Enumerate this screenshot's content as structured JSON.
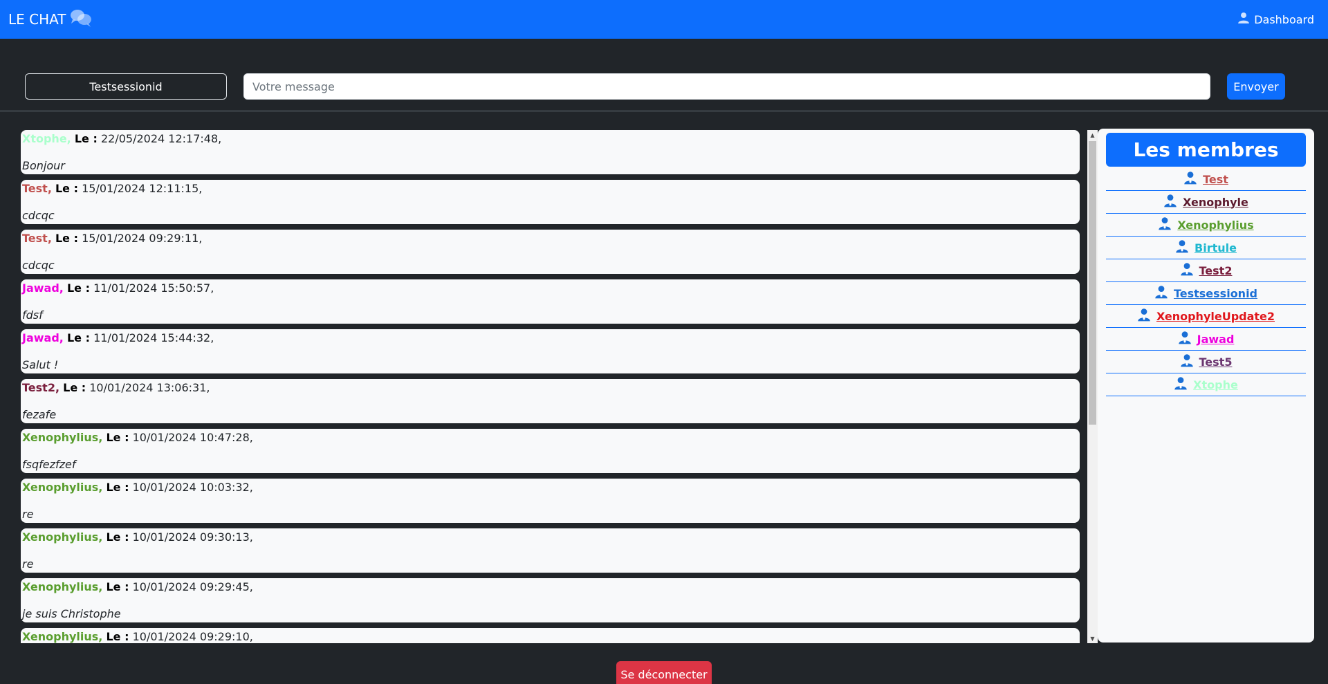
{
  "navbar": {
    "brand": "LE CHAT",
    "dashboard_label": "Dashboard",
    "brand_color": "#0d6efd"
  },
  "compose": {
    "session_name": "Testsessionid",
    "message_placeholder": "Votre message",
    "message_value": "",
    "send_label": "Envoyer"
  },
  "messages": [
    {
      "author": "Xtophe,",
      "le": "Le :",
      "date": "22/05/2024 12:17:48,",
      "text": "Bonjour",
      "color": "#aaffcc"
    },
    {
      "author": "Test,",
      "le": "Le :",
      "date": "15/01/2024 12:11:15,",
      "text": "cdcqc",
      "color": "#c0504d"
    },
    {
      "author": "Test,",
      "le": "Le :",
      "date": "15/01/2024 09:29:11,",
      "text": "cdcqc",
      "color": "#c0504d"
    },
    {
      "author": "Jawad,",
      "le": "Le :",
      "date": "11/01/2024 15:50:57,",
      "text": "fdsf",
      "color": "#ee00dd"
    },
    {
      "author": "Jawad,",
      "le": "Le :",
      "date": "11/01/2024 15:44:32,",
      "text": "Salut !",
      "color": "#ee00dd"
    },
    {
      "author": "Test2,",
      "le": "Le :",
      "date": "10/01/2024 13:06:31,",
      "text": "fezafe",
      "color": "#7a1f3d"
    },
    {
      "author": "Xenophylius,",
      "le": "Le :",
      "date": "10/01/2024 10:47:28,",
      "text": "fsqfezfzef",
      "color": "#5a9e2f"
    },
    {
      "author": "Xenophylius,",
      "le": "Le :",
      "date": "10/01/2024 10:03:32,",
      "text": "re",
      "color": "#5a9e2f"
    },
    {
      "author": "Xenophylius,",
      "le": "Le :",
      "date": "10/01/2024 09:30:13,",
      "text": "re",
      "color": "#5a9e2f"
    },
    {
      "author": "Xenophylius,",
      "le": "Le :",
      "date": "10/01/2024 09:29:45,",
      "text": "je suis Christophe",
      "color": "#5a9e2f"
    },
    {
      "author": "Xenophylius,",
      "le": "Le :",
      "date": "10/01/2024 09:29:10,",
      "text": "",
      "color": "#5a9e2f"
    }
  ],
  "members_panel": {
    "title": "Les membres",
    "members": [
      {
        "name": "Test",
        "color": "#c0504d"
      },
      {
        "name": "Xenophyle",
        "color": "#5c1a2e"
      },
      {
        "name": "Xenophylius",
        "color": "#5a9e2f"
      },
      {
        "name": "Birtule",
        "color": "#1fb8d0"
      },
      {
        "name": "Test2",
        "color": "#7a1f3d"
      },
      {
        "name": "Testsessionid",
        "color": "#1a6fd6"
      },
      {
        "name": "XenophyleUpdate2",
        "color": "#e0161b"
      },
      {
        "name": "Jawad",
        "color": "#ee00dd"
      },
      {
        "name": "Test5",
        "color": "#6b3570"
      },
      {
        "name": "Xtophe",
        "color": "#aaffcc"
      }
    ]
  },
  "footer": {
    "logout_label": "Se déconnecter"
  }
}
